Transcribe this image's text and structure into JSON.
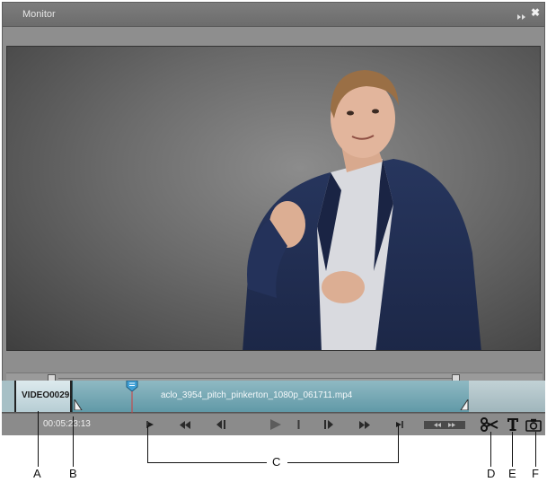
{
  "panel": {
    "title": "Monitor",
    "close_glyph": "✖"
  },
  "timeline": {
    "first_clip_label": "VIDEO0029.",
    "main_clip_label": "aclo_3954_pitch_pinkerton_1080p_061711.mp4"
  },
  "controls": {
    "timecode": "00:05:23:13",
    "icons": [
      "set-in-point-icon",
      "rewind-icon",
      "step-back-icon",
      "play-icon",
      "split-divider-icon",
      "step-forward-icon",
      "fast-forward-icon",
      "set-out-point-icon",
      "shuttle-icon",
      "scissors-icon",
      "text-tool-icon",
      "camera-icon"
    ]
  },
  "callouts": {
    "a": "A",
    "b": "B",
    "c": "C",
    "d": "D",
    "e": "E",
    "f": "F"
  },
  "colors": {
    "panel_bg": "#8e8e8e",
    "clip_main": "#6ea3af",
    "playhead": "#3fa0d6"
  }
}
